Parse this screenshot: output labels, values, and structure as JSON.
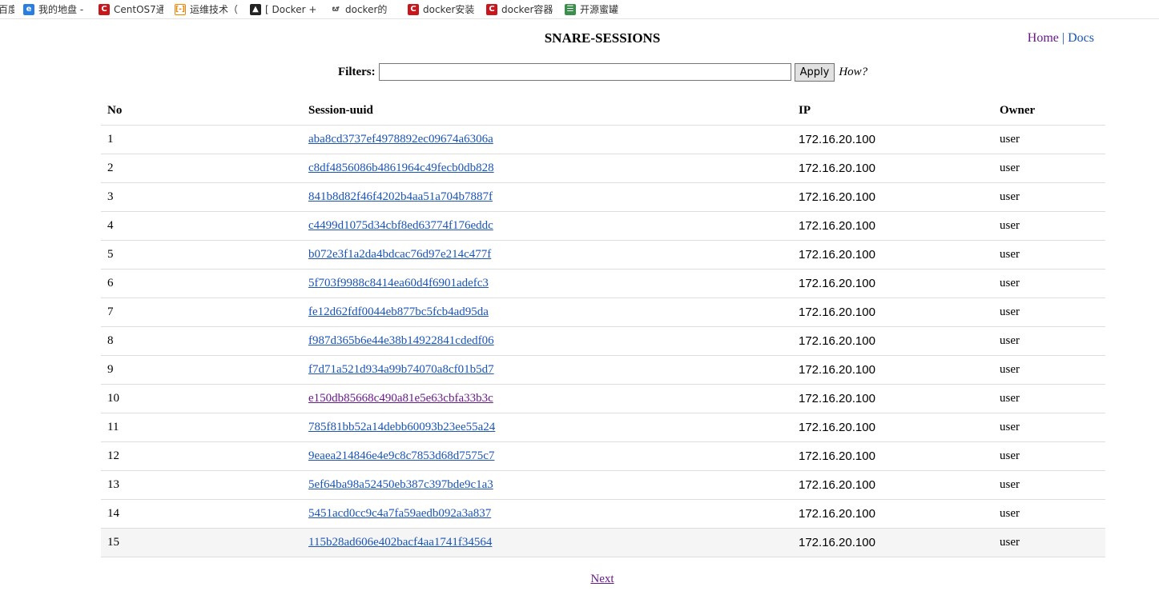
{
  "bookmarks": [
    {
      "label": "百度",
      "icon": "none"
    },
    {
      "label": "我的地盘 -",
      "icon": "globe-icon"
    },
    {
      "label": "CentOS7通",
      "icon": "csdn-icon"
    },
    {
      "label": "运维技术（",
      "icon": "brackets-icon"
    },
    {
      "label": "[ Docker +",
      "icon": "cat-icon"
    },
    {
      "label": "docker的",
      "icon": "feather-icon"
    },
    {
      "label": "docker安装",
      "icon": "csdn-icon"
    },
    {
      "label": "docker容器",
      "icon": "csdn-icon"
    },
    {
      "label": "开源蜜罐",
      "icon": "bars-icon"
    }
  ],
  "header": {
    "title": "SNARE-SESSIONS",
    "home_label": "Home",
    "separator": "|",
    "docs_label": "Docs"
  },
  "filter": {
    "label": "Filters:",
    "value": "",
    "placeholder": "",
    "apply_label": "Apply",
    "how_label": "How?"
  },
  "table": {
    "columns": [
      "No",
      "Session-uuid",
      "IP",
      "Owner"
    ],
    "rows": [
      {
        "no": "1",
        "uuid": "aba8cd3737ef4978892ec09674a6306a",
        "ip": "172.16.20.100",
        "owner": "user"
      },
      {
        "no": "2",
        "uuid": "c8df4856086b4861964c49fecb0db828",
        "ip": "172.16.20.100",
        "owner": "user"
      },
      {
        "no": "3",
        "uuid": "841b8d82f46f4202b4aa51a704b7887f",
        "ip": "172.16.20.100",
        "owner": "user"
      },
      {
        "no": "4",
        "uuid": "c4499d1075d34cbf8ed63774f176eddc",
        "ip": "172.16.20.100",
        "owner": "user"
      },
      {
        "no": "5",
        "uuid": "b072e3f1a2da4bdcac76d97e214c477f",
        "ip": "172.16.20.100",
        "owner": "user"
      },
      {
        "no": "6",
        "uuid": "5f703f9988c8414ea60d4f6901adefc3",
        "ip": "172.16.20.100",
        "owner": "user"
      },
      {
        "no": "7",
        "uuid": "fe12d62fdf0044eb877bc5fcb4ad95da",
        "ip": "172.16.20.100",
        "owner": "user"
      },
      {
        "no": "8",
        "uuid": "f987d365b6e44e38b14922841cdedf06",
        "ip": "172.16.20.100",
        "owner": "user"
      },
      {
        "no": "9",
        "uuid": "f7d71a521d934a99b74070a8cf01b5d7",
        "ip": "172.16.20.100",
        "owner": "user"
      },
      {
        "no": "10",
        "uuid": "e150db85668c490a81e5e63cbfa33b3c",
        "ip": "172.16.20.100",
        "owner": "user",
        "visited": true
      },
      {
        "no": "11",
        "uuid": "785f81bb52a14debb60093b23ee55a24",
        "ip": "172.16.20.100",
        "owner": "user"
      },
      {
        "no": "12",
        "uuid": "9eaea214846e4e9c8c7853d68d7575c7",
        "ip": "172.16.20.100",
        "owner": "user"
      },
      {
        "no": "13",
        "uuid": "5ef64ba98a52450eb387c397bde9c1a3",
        "ip": "172.16.20.100",
        "owner": "user"
      },
      {
        "no": "14",
        "uuid": "5451acd0cc9c4a7fa59aedb092a3a837",
        "ip": "172.16.20.100",
        "owner": "user"
      },
      {
        "no": "15",
        "uuid": "115b28ad606e402bacf4aa1741f34564",
        "ip": "172.16.20.100",
        "owner": "user",
        "hovered": true
      }
    ]
  },
  "pagination": {
    "next_label": "Next"
  },
  "colors": {
    "link": "#1a55b5",
    "visited_link": "#6a1a8a",
    "row_border": "#dddddd",
    "hover_row": "#f5f5f5"
  }
}
